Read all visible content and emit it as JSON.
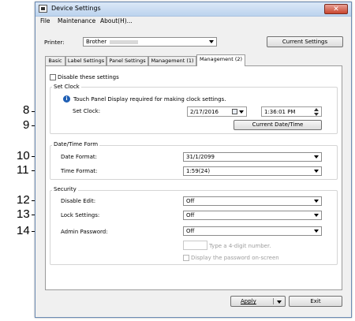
{
  "window": {
    "title": "Device Settings",
    "close_label": "✕"
  },
  "menu": [
    "File",
    "Maintenance",
    "About(H)..."
  ],
  "printer": {
    "label": "Printer:",
    "value": "Brother",
    "current_settings_label": "Current Settings"
  },
  "tabs": [
    "Basic",
    "Label Settings",
    "Panel Settings",
    "Management (1)",
    "Management (2)"
  ],
  "disable_settings_label": "Disable these settings",
  "set_clock": {
    "group_title": "Set Clock",
    "info_text": "Touch Panel Display required for making clock settings.",
    "label": "Set Clock:",
    "date_value": "2/17/2016",
    "time_value": "1:36:01 PM",
    "current_datetime_label": "Current Date/Time"
  },
  "datetime_format": {
    "group_title": "Date/Time Form",
    "date_format_label": "Date Format:",
    "date_format_value": "31/1/2099",
    "time_format_label": "Time Format:",
    "time_format_value": "1:59(24)"
  },
  "security": {
    "group_title": "Security",
    "disable_edit_label": "Disable Edit:",
    "disable_edit_value": "Off",
    "lock_settings_label": "Lock Settings:",
    "lock_settings_value": "Off",
    "admin_password_label": "Admin Password:",
    "admin_password_value": "Off",
    "password_hint": "Type a 4-digit number.",
    "display_password_label": "Display the password on-screen"
  },
  "footer": {
    "apply_label": "Apply",
    "exit_label": "Exit"
  },
  "callouts": [
    "8",
    "9",
    "10",
    "11",
    "12",
    "13",
    "14"
  ]
}
